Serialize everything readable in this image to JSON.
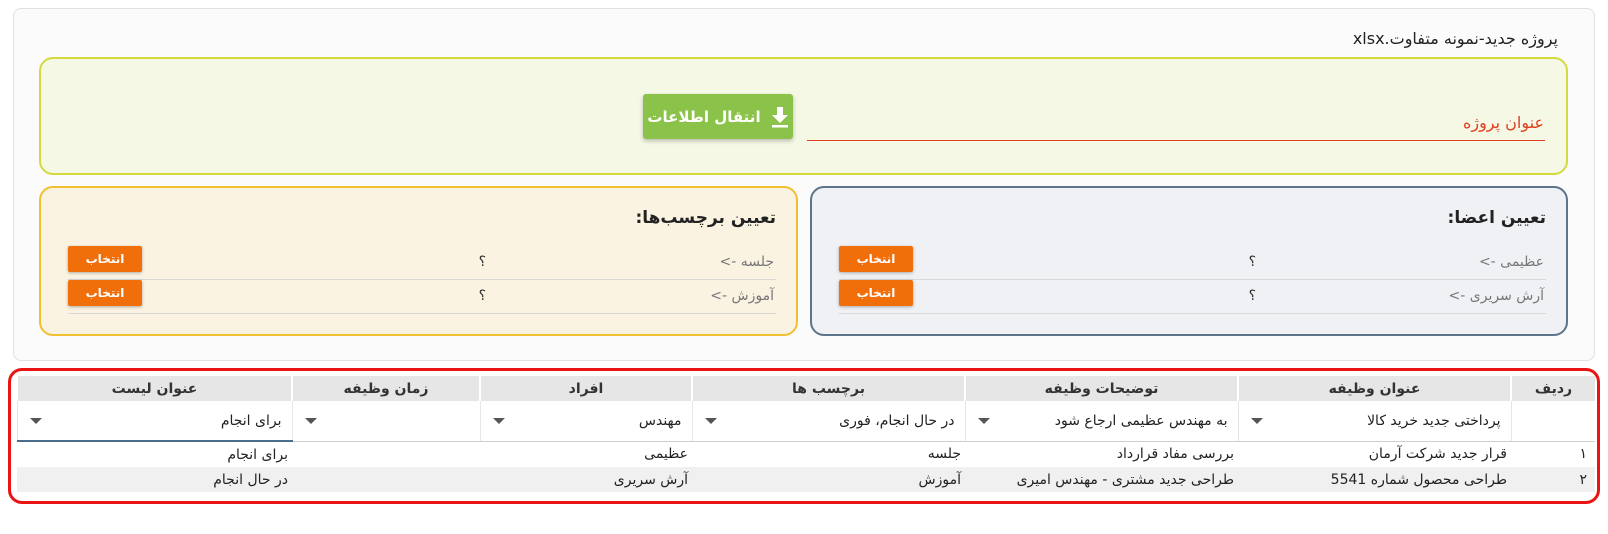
{
  "file_name": "پروژه جدید-نمونه متفاوت.xlsx",
  "project": {
    "title_label": "عنوان پروژه",
    "transfer_button": "انتقال اطلاعات"
  },
  "members_panel": {
    "title": "تعیین اعضا:",
    "rows": [
      {
        "name": "عظیمی ->",
        "mark": "؟",
        "button": "انتخاب"
      },
      {
        "name": "آرش سریری ->",
        "mark": "؟",
        "button": "انتخاب"
      }
    ]
  },
  "tags_panel": {
    "title": "تعیین برچسب‌ها:",
    "rows": [
      {
        "name": "جلسه ->",
        "mark": "؟",
        "button": "انتخاب"
      },
      {
        "name": "آموزش ->",
        "mark": "؟",
        "button": "انتخاب"
      }
    ]
  },
  "table": {
    "headers": [
      "ردیف",
      "عنوان وظیفه",
      "توضیحات وظیفه",
      "برچسب ها",
      "افراد",
      "زمان وظیفه",
      "عنوان لیست"
    ],
    "filters": [
      "",
      "پرداختی جدید خرید کالا",
      "به مهندس عظیمی ارجاع شود",
      "در حال انجام، فوری",
      "مهندس",
      "",
      "برای انجام"
    ],
    "rows": [
      [
        "۱",
        "قرار جدید شرکت آرمان",
        "بررسی مفاد قرارداد",
        "جلسه",
        "عظیمی",
        "",
        "برای انجام"
      ],
      [
        "۲",
        "طراحی محصول شماره 5541",
        "طراحی جدید مشتری - مهندس امیری",
        "آموزش",
        "آرش سریری",
        "",
        "در حال انجام"
      ]
    ]
  },
  "colors": {
    "transfer_green": "#8bc34a",
    "select_orange": "#f16f0a",
    "title_red": "#e0401f",
    "frame_red": "#e81414"
  }
}
